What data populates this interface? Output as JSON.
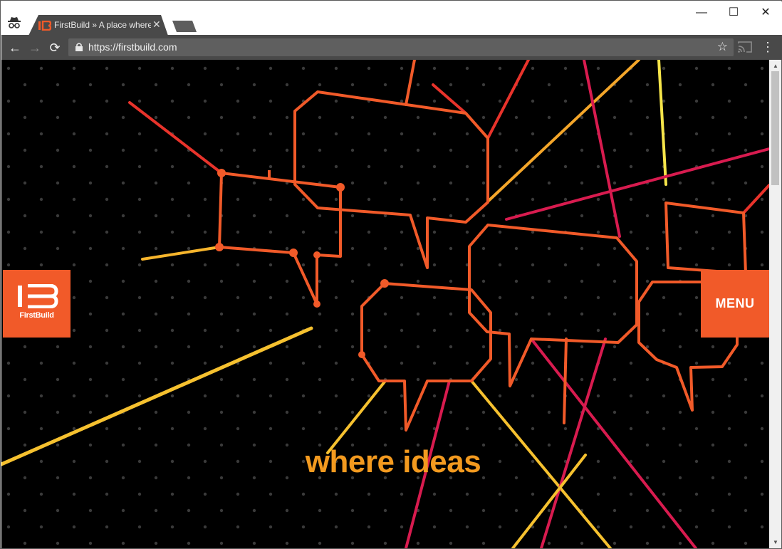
{
  "browser": {
    "tab_title": "FirstBuild » A place where",
    "tab_close": "✕",
    "url": "https://firstbuild.com",
    "window_controls": {
      "minimize": "—",
      "maximize": "☐",
      "close": "✕"
    },
    "nav": {
      "back": "←",
      "forward": "→",
      "reload": "⟳"
    },
    "star": "☆",
    "kebab": "⋮"
  },
  "page": {
    "logo_text": "FirstBuild",
    "menu_label": "MENU",
    "tagline": "where ideas"
  },
  "colors": {
    "brand_orange": "#f15a29",
    "tagline_orange": "#f39a1f",
    "background": "#000000"
  }
}
